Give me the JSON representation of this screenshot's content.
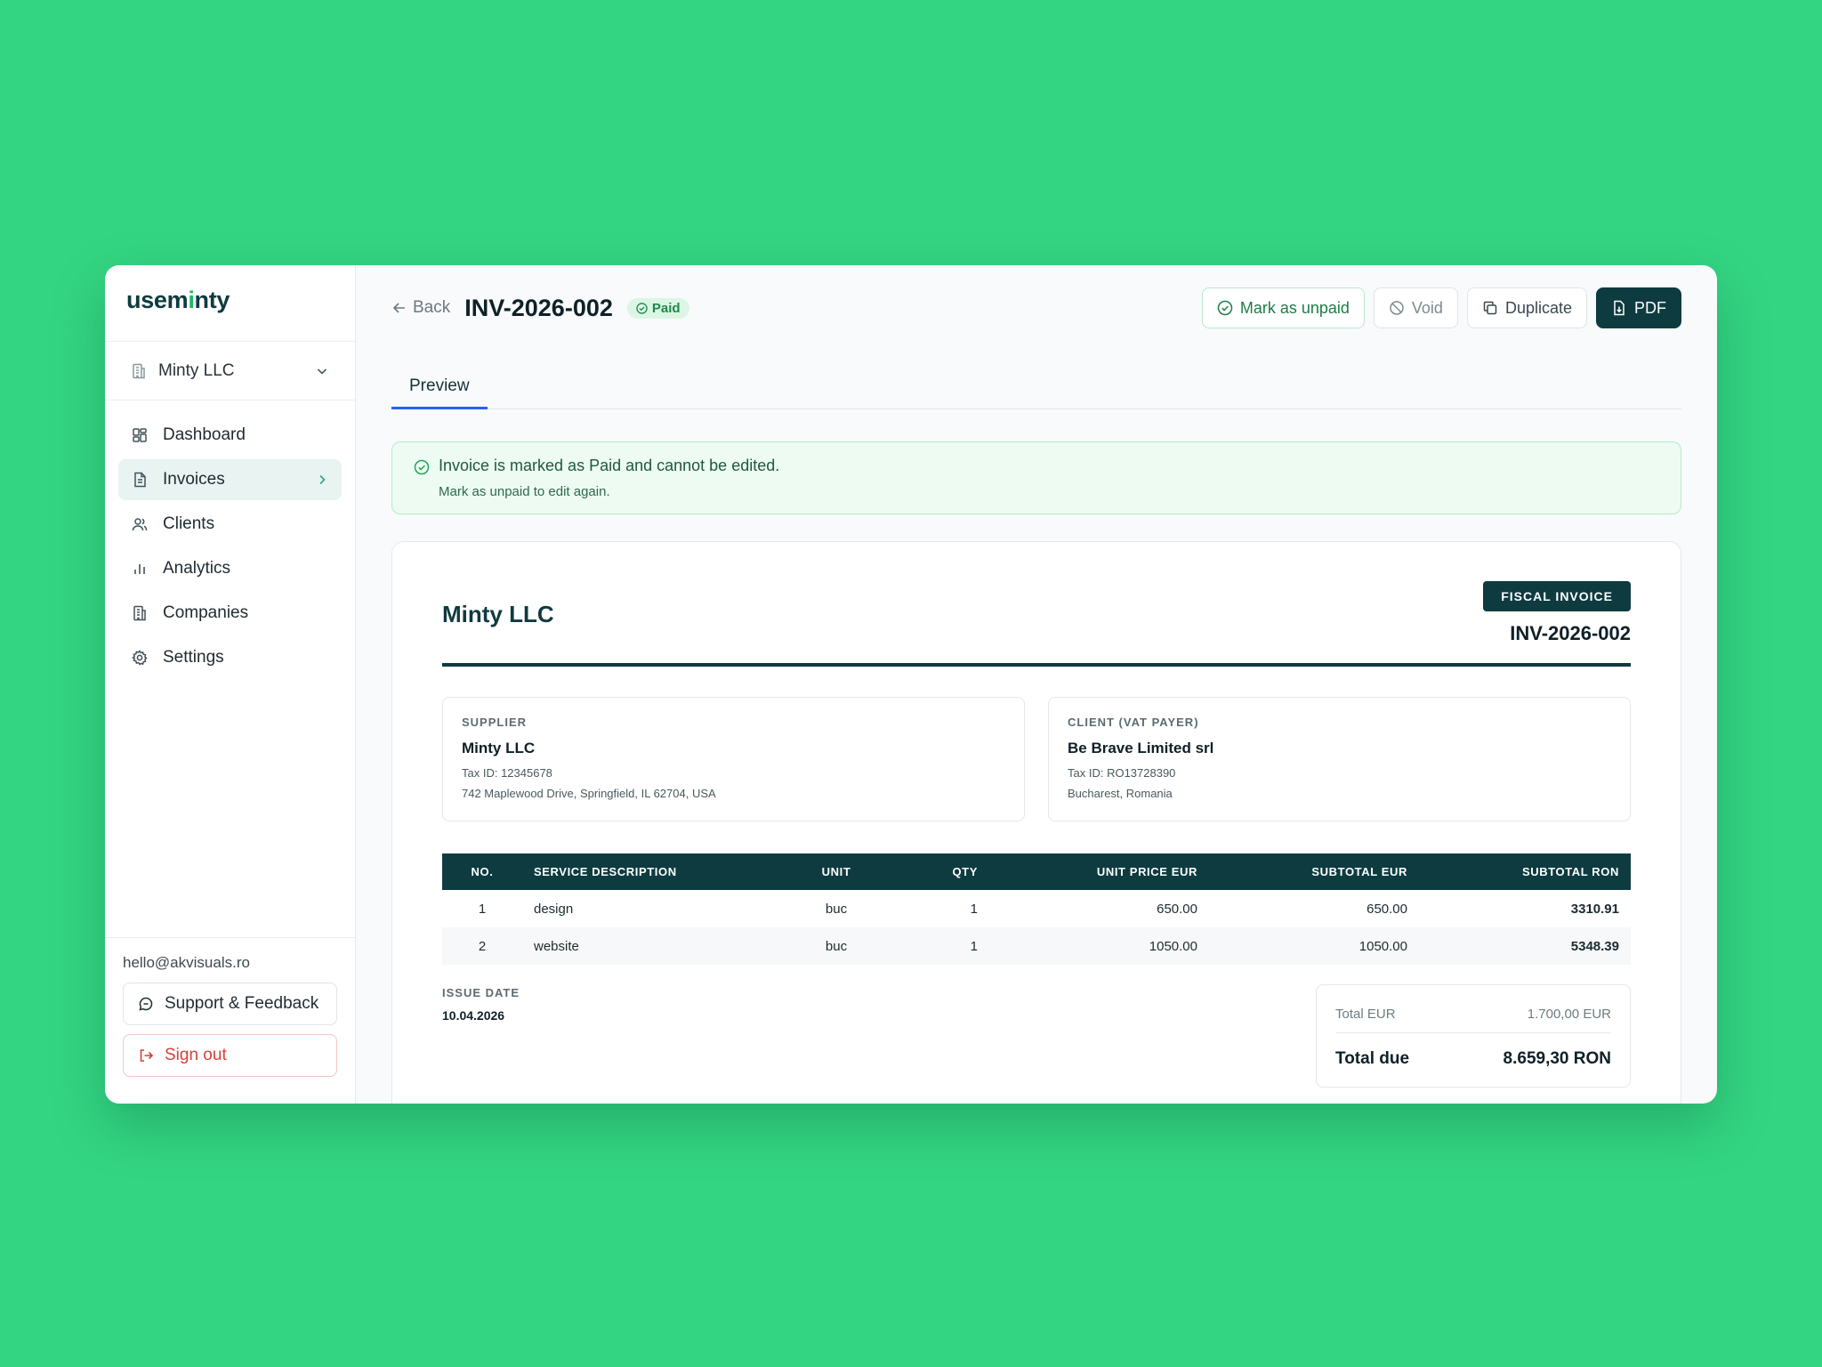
{
  "app": {
    "logo": {
      "text_main": "usem",
      "text_i": "i",
      "text_rest": "nty"
    },
    "company_selector": "Minty LLC"
  },
  "sidebar": {
    "items": [
      {
        "label": "Dashboard",
        "icon": "dashboard-icon"
      },
      {
        "label": "Invoices",
        "icon": "document-icon",
        "active": true
      },
      {
        "label": "Clients",
        "icon": "users-icon"
      },
      {
        "label": "Analytics",
        "icon": "bar-chart-icon"
      },
      {
        "label": "Companies",
        "icon": "building-icon"
      },
      {
        "label": "Settings",
        "icon": "gear-icon"
      }
    ],
    "email": "hello@akvisuals.ro",
    "support_label": "Support & Feedback",
    "signout_label": "Sign out"
  },
  "header": {
    "back_label": "Back",
    "invoice_number": "INV-2026-002",
    "status_badge": "Paid",
    "actions": {
      "mark_unpaid": "Mark as unpaid",
      "void": "Void",
      "duplicate": "Duplicate",
      "pdf": "PDF"
    }
  },
  "tabs": [
    {
      "label": "Preview"
    }
  ],
  "alert": {
    "title": "Invoice is marked as Paid and cannot be edited.",
    "subtitle": "Mark as unpaid to edit again."
  },
  "invoice": {
    "company_name": "Minty LLC",
    "doc_type": "FISCAL INVOICE",
    "number": "INV-2026-002",
    "supplier": {
      "label": "SUPPLIER",
      "name": "Minty LLC",
      "tax_id": "Tax ID: 12345678",
      "address": "742 Maplewood Drive, Springfield, IL 62704, USA"
    },
    "client": {
      "label": "CLIENT (VAT PAYER)",
      "name": "Be Brave Limited srl",
      "tax_id": "Tax ID: RO13728390",
      "address": "Bucharest, Romania"
    },
    "columns": {
      "no": "NO.",
      "desc": "SERVICE DESCRIPTION",
      "unit": "UNIT",
      "qty": "QTY",
      "unit_price": "UNIT PRICE EUR",
      "subtotal_eur": "SUBTOTAL EUR",
      "subtotal_ron": "SUBTOTAL RON"
    },
    "rows": [
      {
        "no": "1",
        "desc": "design",
        "unit": "buc",
        "qty": "1",
        "unit_price": "650.00",
        "subtotal_eur": "650.00",
        "subtotal_ron": "3310.91"
      },
      {
        "no": "2",
        "desc": "website",
        "unit": "buc",
        "qty": "1",
        "unit_price": "1050.00",
        "subtotal_eur": "1050.00",
        "subtotal_ron": "5348.39"
      }
    ],
    "issue_date_label": "ISSUE DATE",
    "issue_date": "10.04.2026",
    "totals": {
      "total_eur_label": "Total EUR",
      "total_eur": "1.700,00 EUR",
      "total_due_label": "Total due",
      "total_due": "8.659,30 RON"
    }
  },
  "colors": {
    "background": "#33d583",
    "brand_dark": "#0d3b40",
    "accent_green": "#1fb66c",
    "tab_underline": "#2563eb",
    "danger": "#d6403a"
  }
}
